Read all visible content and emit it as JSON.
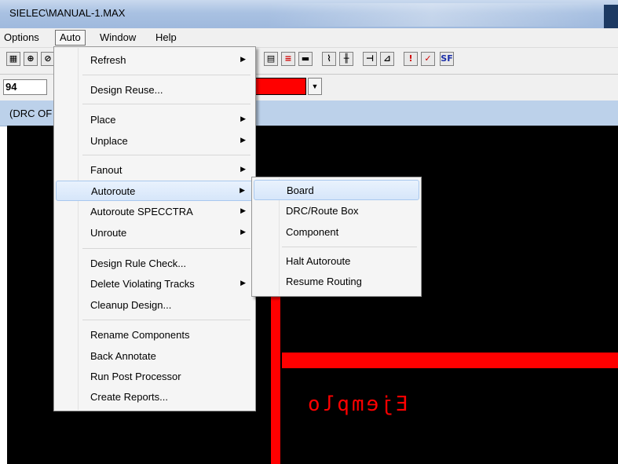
{
  "window": {
    "title": "SIELEC\\MANUAL-1.MAX"
  },
  "menubar": {
    "items": [
      {
        "label": "Options"
      },
      {
        "label": "Auto",
        "active": true
      },
      {
        "label": "Window"
      },
      {
        "label": "Help"
      }
    ]
  },
  "toolbar2": {
    "layer_value": "94"
  },
  "statusbar": {
    "text": "(DRC OF"
  },
  "canvas": {
    "reference_text": "Ejemplo",
    "track_color": "#ff0000"
  },
  "auto_menu": {
    "items": [
      {
        "label": "Refresh",
        "submenu": true
      },
      {
        "label": "Design Reuse...",
        "submenu": false
      },
      {
        "label": "Place",
        "submenu": true
      },
      {
        "label": "Unplace",
        "submenu": true
      },
      {
        "label": "Fanout",
        "submenu": true
      },
      {
        "label": "Autoroute",
        "submenu": true,
        "highlighted": true
      },
      {
        "label": "Autoroute SPECCTRA",
        "submenu": true
      },
      {
        "label": "Unroute",
        "submenu": true
      },
      {
        "label": "Design Rule Check...",
        "submenu": false
      },
      {
        "label": "Delete Violating Tracks",
        "submenu": true
      },
      {
        "label": "Cleanup Design...",
        "submenu": false
      },
      {
        "label": "Rename Components",
        "submenu": false
      },
      {
        "label": "Back Annotate",
        "submenu": false
      },
      {
        "label": "Run Post Processor",
        "submenu": false
      },
      {
        "label": "Create Reports...",
        "submenu": false
      }
    ]
  },
  "autoroute_submenu": {
    "items": [
      {
        "label": "Board",
        "highlighted": true
      },
      {
        "label": "DRC/Route Box"
      },
      {
        "label": "Component"
      },
      {
        "label": "Halt Autoroute"
      },
      {
        "label": "Resume Routing"
      }
    ]
  },
  "icons": {
    "submenu_arrow": "▶"
  }
}
